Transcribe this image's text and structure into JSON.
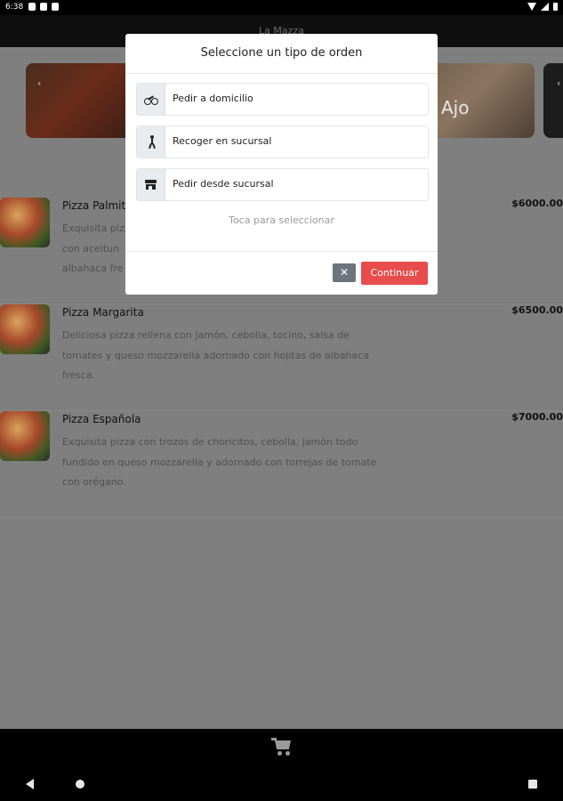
{
  "status_bar": {
    "time": "6:38"
  },
  "app_bar": {
    "title": "La Mazza"
  },
  "carousel": {
    "prev_icon": "‹",
    "next_icon": "‹",
    "right_card_text": "Ajo"
  },
  "menu": {
    "items": [
      {
        "name": "Pizza Palmito",
        "description_lines": [
          "Exquisita pizz",
          "con aceitun",
          "albahaca fre"
        ],
        "price": "$6000.00"
      },
      {
        "name": "Pizza Margarita",
        "description_lines": [
          "Deliciosa pizza rellena con jamón, cebolla, tocino, salsa de",
          "tomates y queso mozzarella adornado con hojitas de albahaca",
          "fresca."
        ],
        "price": "$6500.00"
      },
      {
        "name": "Pizza Española",
        "description_lines": [
          "Exquisita pizza con trozos de choricitos, cebolla, jamón todo",
          "fundido en queso mozzarella y adornado con torrejas de tomate",
          "con orégano."
        ],
        "price": "$7000.00"
      }
    ]
  },
  "modal": {
    "title": "Seleccione un tipo de orden",
    "options": [
      {
        "label": "Pedir a domicilio",
        "icon": "bicycle-icon"
      },
      {
        "label": "Recoger en sucursal",
        "icon": "walking-icon"
      },
      {
        "label": "Pedir desde sucursal",
        "icon": "store-icon"
      }
    ],
    "hint": "Toca para seleccionar",
    "close_label": "✕",
    "continue_label": "Continuar"
  },
  "bottom_bar": {
    "cart_icon": "cart-icon"
  },
  "colors": {
    "overlay": "#7f7f7f",
    "continue_button": "#e84c4c",
    "close_button": "#6c757d"
  }
}
